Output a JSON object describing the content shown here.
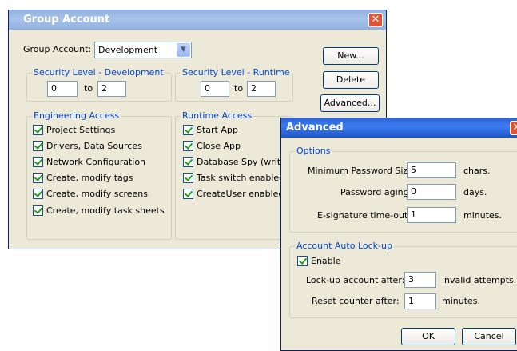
{
  "group_dialog": {
    "title": "Group Account",
    "close_glyph": "✕",
    "group_account_label": "Group Account:",
    "group_account_value": "Development",
    "dropdown_glyph": "▼",
    "sec_dev": {
      "title": "Security Level - Development",
      "from": "0",
      "to_label": "to",
      "to": "2"
    },
    "sec_run": {
      "title": "Security Level - Runtime",
      "from": "0",
      "to_label": "to",
      "to": "2"
    },
    "buttons": {
      "new": "New...",
      "delete": "Delete",
      "advanced": "Advanced..."
    },
    "engineering": {
      "title": "Engineering Access",
      "items": [
        "Project Settings",
        "Drivers, Data Sources",
        "Network Configuration",
        "Create, modify tags",
        "Create, modify screens",
        "Create, modify task sheets"
      ]
    },
    "runtime": {
      "title": "Runtime Access",
      "items": [
        "Start App",
        "Close App",
        "Database Spy (write)",
        "Task switch enabled",
        "CreateUser enabled"
      ]
    }
  },
  "advanced_dialog": {
    "title": "Advanced",
    "options": {
      "title": "Options",
      "min_pw_label": "Minimum Password Size:",
      "min_pw_value": "5",
      "min_pw_unit": "chars.",
      "aging_label": "Password aging:",
      "aging_value": "0",
      "aging_unit": "days.",
      "esig_label": "E-signature time-out:",
      "esig_value": "1",
      "esig_unit": "minutes."
    },
    "lockup": {
      "title": "Account Auto Lock-up",
      "enable_label": "Enable",
      "lock_label": "Lock-up account after:",
      "lock_value": "3",
      "lock_unit": "invalid attempts.",
      "reset_label": "Reset counter after:",
      "reset_value": "1",
      "reset_unit": "minutes."
    },
    "ok": "OK",
    "cancel": "Cancel"
  }
}
